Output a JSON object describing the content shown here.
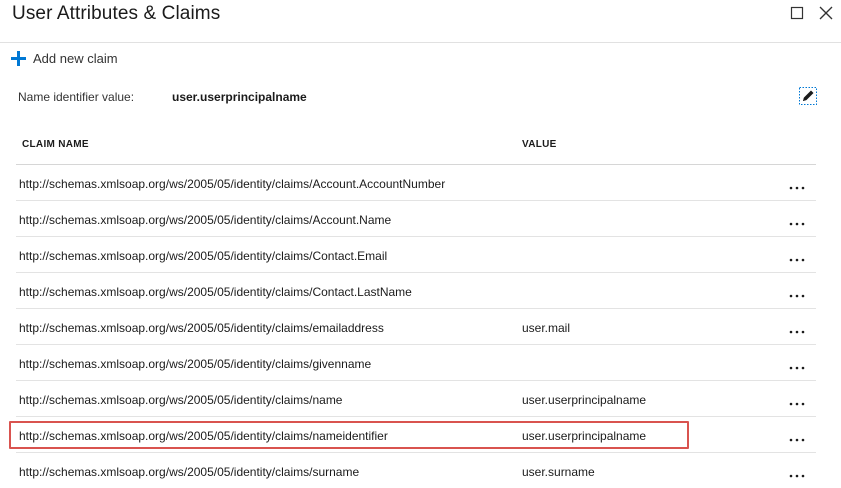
{
  "window": {
    "title": "User Attributes & Claims"
  },
  "commands": {
    "add_claim": "Add new claim"
  },
  "name_identifier": {
    "label": "Name identifier value:",
    "value": "user.userprincipalname"
  },
  "table": {
    "columns": {
      "claim_name": "CLAIM NAME",
      "value": "VALUE"
    },
    "rows": [
      {
        "claim": "http://schemas.xmlsoap.org/ws/2005/05/identity/claims/Account.AccountNumber",
        "value": ""
      },
      {
        "claim": "http://schemas.xmlsoap.org/ws/2005/05/identity/claims/Account.Name",
        "value": ""
      },
      {
        "claim": "http://schemas.xmlsoap.org/ws/2005/05/identity/claims/Contact.Email",
        "value": ""
      },
      {
        "claim": "http://schemas.xmlsoap.org/ws/2005/05/identity/claims/Contact.LastName",
        "value": ""
      },
      {
        "claim": "http://schemas.xmlsoap.org/ws/2005/05/identity/claims/emailaddress",
        "value": "user.mail"
      },
      {
        "claim": "http://schemas.xmlsoap.org/ws/2005/05/identity/claims/givenname",
        "value": ""
      },
      {
        "claim": "http://schemas.xmlsoap.org/ws/2005/05/identity/claims/name",
        "value": "user.userprincipalname"
      },
      {
        "claim": "http://schemas.xmlsoap.org/ws/2005/05/identity/claims/nameidentifier",
        "value": "user.userprincipalname"
      },
      {
        "claim": "http://schemas.xmlsoap.org/ws/2005/05/identity/claims/surname",
        "value": "user.surname"
      }
    ],
    "highlighted_row": 7
  },
  "icons": {
    "add": "plus-icon",
    "edit": "edit-pencil-icon",
    "row_menu": "more-options-icon",
    "maximize": "maximize-icon",
    "close": "close-icon"
  },
  "colors": {
    "accent": "#0078d4",
    "highlight_border": "#d9534f"
  }
}
